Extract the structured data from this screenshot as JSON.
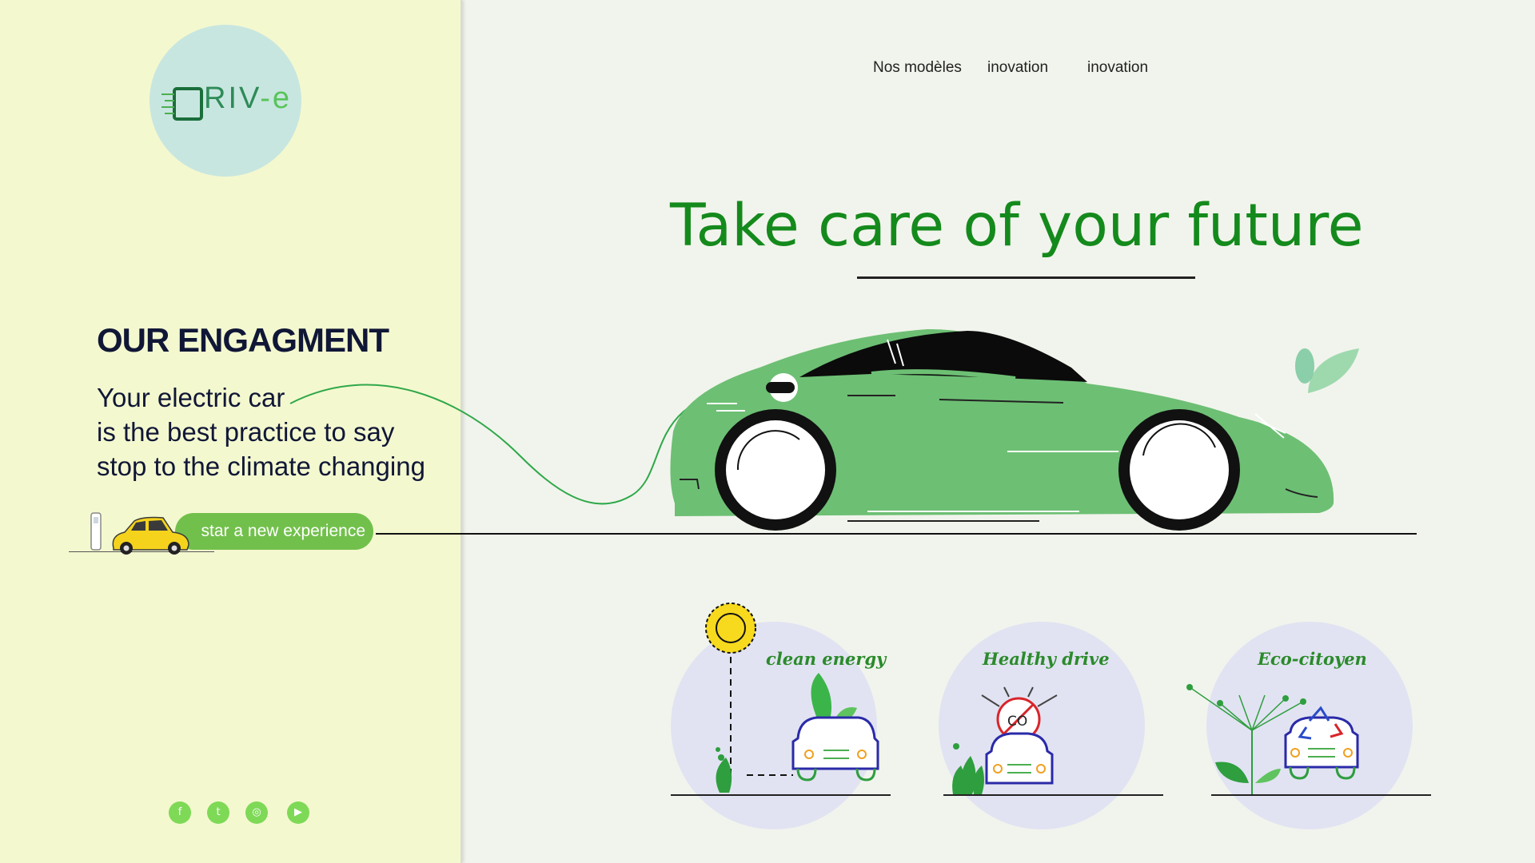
{
  "brand": {
    "logo_main": "RIV",
    "logo_dash": "-e"
  },
  "nav": {
    "items": [
      "Nos modèles",
      "inovation",
      "inovation"
    ]
  },
  "hero": {
    "headline": "Take care of your future"
  },
  "engagement": {
    "title": "OUR ENGAGMENT",
    "lines": [
      "Your electric car",
      "is the best practice to say",
      "stop to the climate changing"
    ]
  },
  "cta": {
    "label": "star a new experience"
  },
  "features": [
    {
      "label": "clean energy"
    },
    {
      "label": "Healthy drive"
    },
    {
      "label": "Eco-citoyen"
    }
  ],
  "social": {
    "icons": [
      "facebook-icon",
      "twitter-icon",
      "instagram-icon",
      "youtube-icon"
    ]
  },
  "colors": {
    "sidebar_bg": "#f4f8cf",
    "main_bg": "#f1f4ec",
    "logo_circle": "#c8e6e0",
    "headline": "#148a1c",
    "car_body": "#6dbf74",
    "cta": "#72c04c",
    "feature_circle": "#e1e3f2",
    "social": "#7ed957"
  }
}
